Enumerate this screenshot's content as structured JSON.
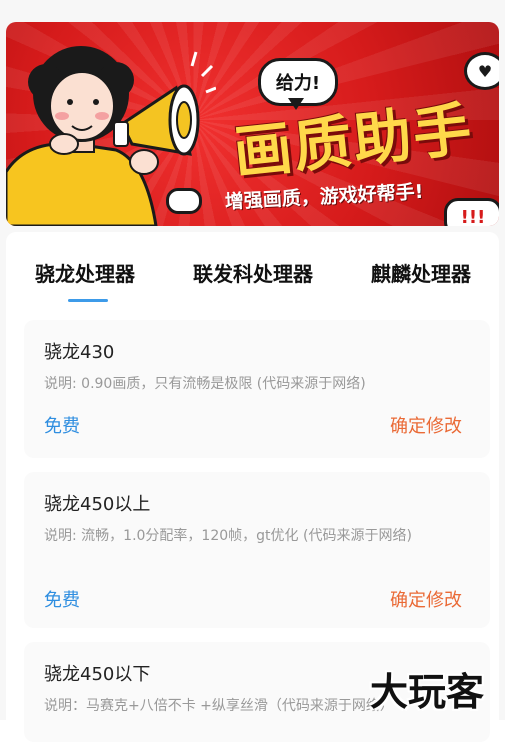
{
  "banner": {
    "badge": "给力!",
    "title": "画质助手",
    "subtitle": "增强画质，游戏好帮手!",
    "exclaim": "!!!"
  },
  "tabs": [
    {
      "label": "骁龙处理器"
    },
    {
      "label": "联发科处理器"
    },
    {
      "label": "麒麟处理器"
    }
  ],
  "items": [
    {
      "title": "骁龙430",
      "desc": "说明: 0.90画质，只有流畅是极限 (代码来源于网络)",
      "price": "免费",
      "action": "确定修改"
    },
    {
      "title": "骁龙450以上",
      "desc": "说明: 流畅，1.0分配率，120帧，gt优化 (代码来源于网络)",
      "price": "免费",
      "action": "确定修改"
    },
    {
      "title": "骁龙450以下",
      "desc": "说明：马赛克+八倍不卡 +纵享丝滑（代码来源于网络）"
    }
  ],
  "watermark": "大玩客",
  "colors": {
    "accent_blue": "#2f8ee0",
    "action_orange": "#ea6a36",
    "banner_red": "#d61b1b",
    "banner_yellow": "#ffd84a"
  }
}
